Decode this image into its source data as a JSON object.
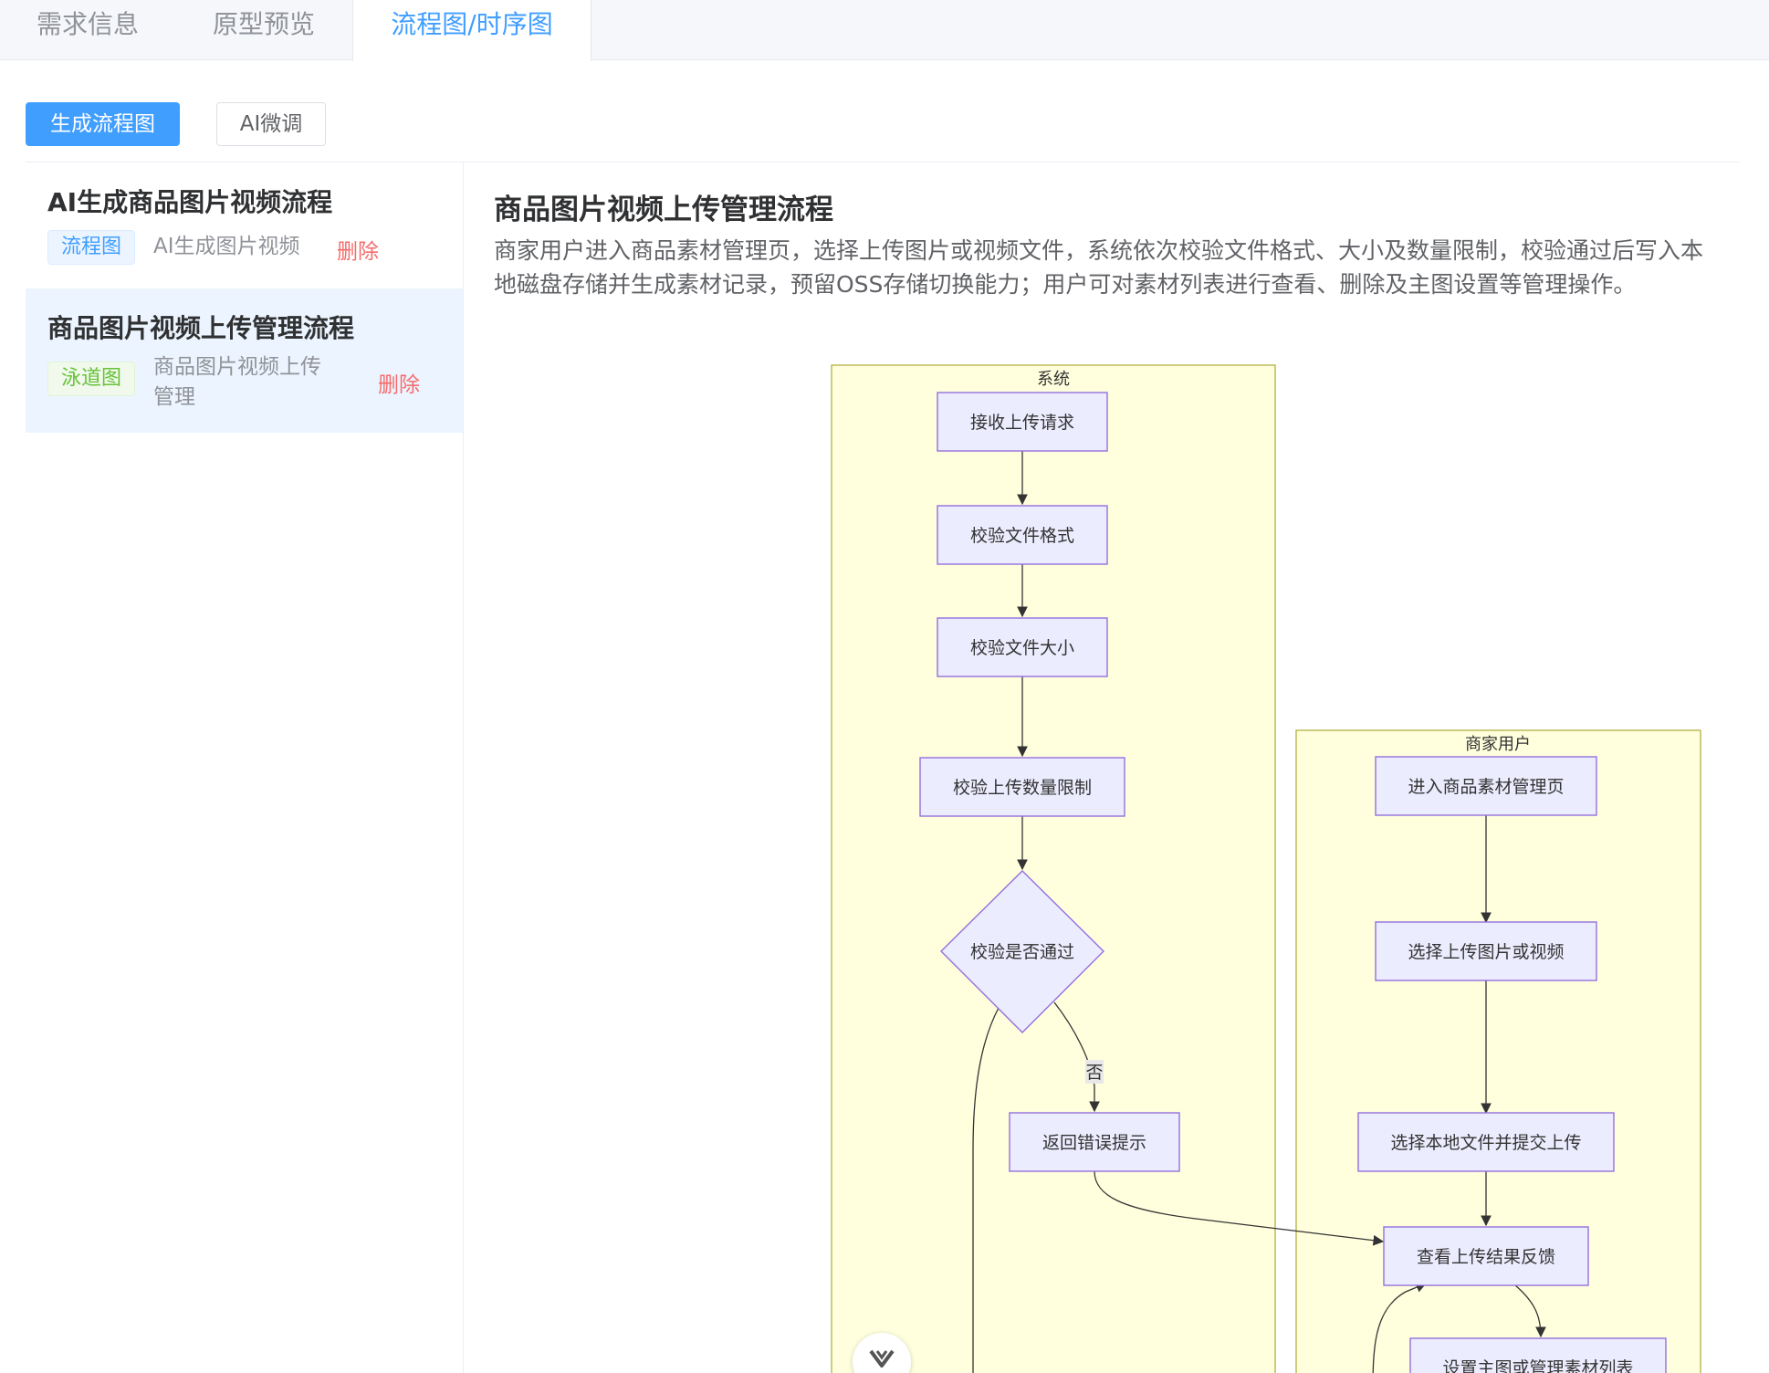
{
  "tabs": [
    {
      "label": "需求信息"
    },
    {
      "label": "原型预览"
    },
    {
      "label": "流程图/时序图"
    }
  ],
  "toolbar": {
    "generate_label": "生成流程图",
    "tune_label": "AI微调"
  },
  "sidebar": {
    "items": [
      {
        "title": "AI生成商品图片视频流程",
        "tag": "流程图",
        "subtitle": "AI生成图片视频",
        "delete_label": "删除"
      },
      {
        "title": "商品图片视频上传管理流程",
        "tag": "泳道图",
        "subtitle_line1": "商品图片视频上传",
        "subtitle_line2": "管理",
        "delete_label": "删除"
      }
    ]
  },
  "main": {
    "title": "商品图片视频上传管理流程",
    "description": "商家用户进入商品素材管理页，选择上传图片或视频文件，系统依次校验文件格式、大小及数量限制，校验通过后写入本地磁盘存储并生成素材记录，预留OSS存储切换能力；用户可对素材列表进行查看、删除及主图设置等管理操作。"
  },
  "diagram": {
    "lanes": {
      "system": "系统",
      "merchant": "商家用户"
    },
    "nodes": {
      "receive": "接收上传请求",
      "check_format": "校验文件格式",
      "check_size": "校验文件大小",
      "check_count": "校验上传数量限制",
      "check_pass": "校验是否通过",
      "error": "返回错误提示",
      "enter": "进入商品素材管理页",
      "select": "选择上传图片或视频",
      "submit": "选择本地文件并提交上传",
      "feedback": "查看上传结果反馈",
      "manage": "设置主图或管理素材列表"
    },
    "edge_labels": {
      "no": "否"
    },
    "colors": {
      "lane_fill": "#ffffde",
      "lane_stroke": "#aaaa33",
      "node_fill": "#ececff",
      "node_stroke": "#9370db"
    }
  },
  "icons": {
    "scroll": "chevron-down-icon"
  },
  "colors": {
    "primary": "#409eff",
    "danger": "#f56c6c",
    "success": "#67c23a"
  }
}
